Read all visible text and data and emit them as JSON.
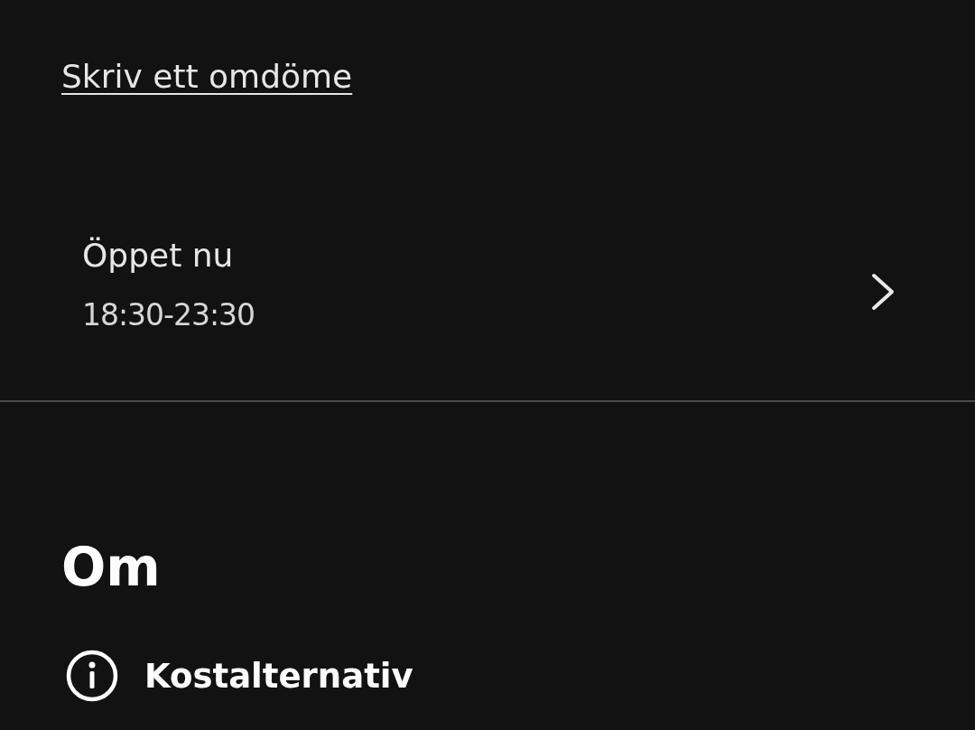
{
  "review_link": "Skriv ett omdöme",
  "hours": {
    "status": "Öppet nu",
    "time": "18:30-23:30"
  },
  "about": {
    "heading": "Om",
    "items": [
      {
        "label": "Kostalternativ"
      }
    ]
  }
}
